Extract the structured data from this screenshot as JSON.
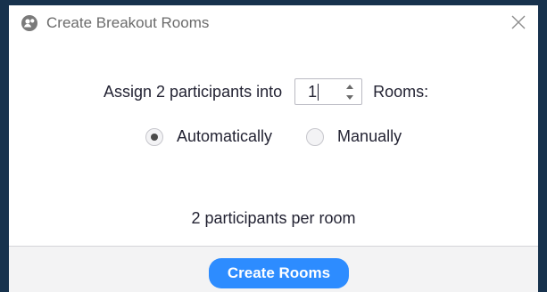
{
  "window": {
    "title": "Create Breakout Rooms",
    "icon": "zoom-app-icon"
  },
  "assign": {
    "prefix": "Assign 2 participants into",
    "rooms_value": "1",
    "suffix": "Rooms:"
  },
  "mode": {
    "options": [
      {
        "label": "Automatically",
        "selected": true
      },
      {
        "label": "Manually",
        "selected": false
      }
    ]
  },
  "summary": "2 participants per room",
  "footer": {
    "create_label": "Create Rooms"
  },
  "colors": {
    "primary_button": "#2d8cff",
    "background_frame": "#17324d"
  }
}
